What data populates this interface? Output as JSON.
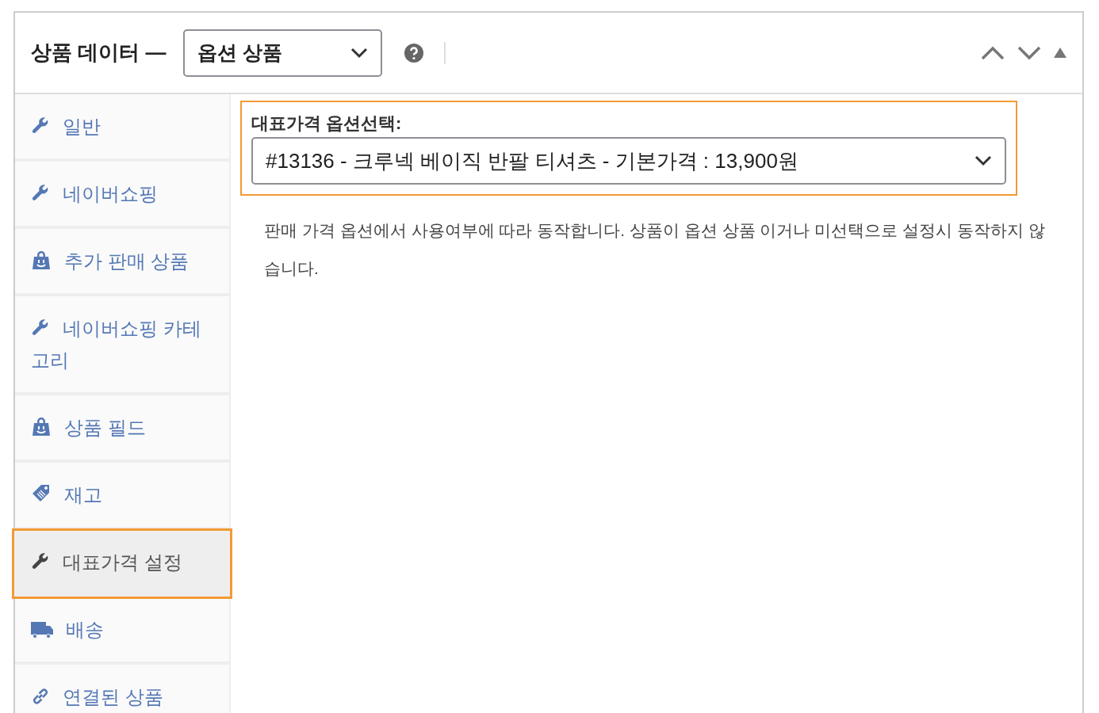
{
  "header": {
    "title": "상품 데이터 —",
    "product_type": "옵션 상품"
  },
  "tabs": [
    {
      "label": "일반",
      "kind": "wrench",
      "selected": false
    },
    {
      "label": "네이버쇼핑",
      "kind": "wrench",
      "selected": false
    },
    {
      "label": "추가 판매 상품",
      "kind": "bag",
      "selected": false
    },
    {
      "label": "네이버쇼핑 카테고리",
      "kind": "wrench",
      "selected": false
    },
    {
      "label": "상품 필드",
      "kind": "bag",
      "selected": false
    },
    {
      "label": "재고",
      "kind": "tag",
      "selected": false
    },
    {
      "label": "대표가격 설정",
      "kind": "wrench",
      "selected": true
    },
    {
      "label": "배송",
      "kind": "truck",
      "selected": false
    },
    {
      "label": "연결된 상품",
      "kind": "link",
      "selected": false
    }
  ],
  "field": {
    "label": "대표가격 옵션선택:",
    "value": "#13136 - 크루넥 베이직 반팔 티셔츠 - 기본가격 : 13,900원"
  },
  "description": "판매 가격 옵션에서 사용여부에 따라 동작합니다. 상품이 옵션 상품 이거나 미선택으로 설정시 동작하지 않습니다."
}
